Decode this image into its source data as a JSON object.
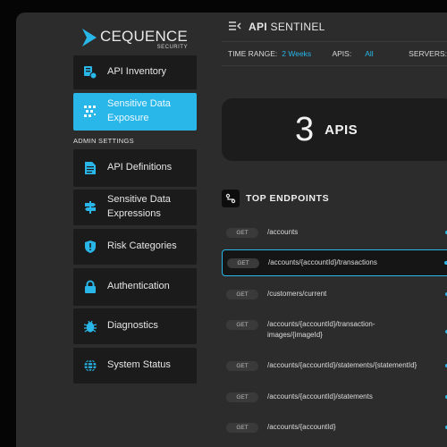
{
  "brand": {
    "name": "CEQUENCE",
    "sub": "SECURITY"
  },
  "sidebar": {
    "section_label": "ADMIN SETTINGS",
    "items": [
      {
        "label": "API Inventory",
        "icon": "api-inventory-icon",
        "active": false
      },
      {
        "label": "Sensitive Data Exposure",
        "icon": "qr-grid-icon",
        "active": true
      },
      {
        "label": "API Definitions",
        "icon": "document-icon",
        "active": false
      },
      {
        "label": "Sensitive Data Expressions",
        "icon": "signpost-icon",
        "active": false
      },
      {
        "label": "Risk Categories",
        "icon": "shield-icon",
        "active": false
      },
      {
        "label": "Authentication",
        "icon": "lock-icon",
        "active": false
      },
      {
        "label": "Diagnostics",
        "icon": "bug-icon",
        "active": false
      },
      {
        "label": "System Status",
        "icon": "globe-icon",
        "active": false
      }
    ]
  },
  "header": {
    "title_bold": "API",
    "title_rest": "SENTINEL"
  },
  "filters": {
    "time_range_label": "TIME RANGE:",
    "time_range_value": "2 Weeks",
    "apis_label": "APIS:",
    "apis_value": "All",
    "servers_label": "SERVERS:"
  },
  "kpi": {
    "value": "3",
    "label": "APIS"
  },
  "endpoints": {
    "title": "TOP ENDPOINTS",
    "rows": [
      {
        "method": "GET",
        "path": "/accounts"
      },
      {
        "method": "GET",
        "path": "/accounts/{accountId}/transactions",
        "highlighted": true
      },
      {
        "method": "GET",
        "path": "/customers/current"
      },
      {
        "method": "GET",
        "path": "/accounts/{accountId}/transaction-images/{imageId}"
      },
      {
        "method": "GET",
        "path": "/accounts/{accountId}/statements/{statementId}"
      },
      {
        "method": "GET",
        "path": "/accounts/{accountId}/statements"
      },
      {
        "method": "GET",
        "path": "/accounts/{accountId}"
      }
    ]
  },
  "colors": {
    "accent": "#29b6e8",
    "panel": "#1b1b1b",
    "background": "#2c2c2c"
  }
}
